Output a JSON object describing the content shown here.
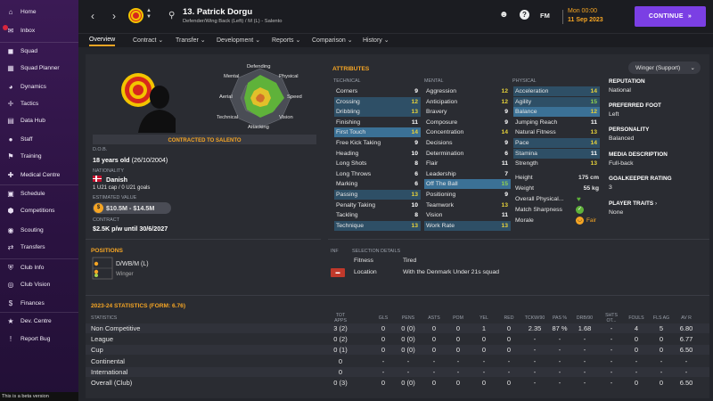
{
  "sidebar": {
    "items": [
      {
        "label": "Home",
        "icon": "home-icon"
      },
      {
        "label": "Inbox",
        "icon": "inbox-icon"
      },
      {
        "label": "Squad",
        "icon": "squad-icon"
      },
      {
        "label": "Squad Planner",
        "icon": "squad-planner-icon"
      },
      {
        "label": "Dynamics",
        "icon": "dynamics-icon"
      },
      {
        "label": "Tactics",
        "icon": "tactics-icon"
      },
      {
        "label": "Data Hub",
        "icon": "data-hub-icon"
      },
      {
        "label": "Staff",
        "icon": "staff-icon"
      },
      {
        "label": "Training",
        "icon": "training-icon"
      },
      {
        "label": "Medical Centre",
        "icon": "medical-icon"
      },
      {
        "label": "Schedule",
        "icon": "schedule-icon"
      },
      {
        "label": "Competitions",
        "icon": "competitions-icon"
      },
      {
        "label": "Scouting",
        "icon": "scouting-icon"
      },
      {
        "label": "Transfers",
        "icon": "transfers-icon"
      },
      {
        "label": "Club Info",
        "icon": "club-info-icon"
      },
      {
        "label": "Club Vision",
        "icon": "club-vision-icon"
      },
      {
        "label": "Finances",
        "icon": "finances-icon"
      },
      {
        "label": "Dev. Centre",
        "icon": "dev-centre-icon"
      },
      {
        "label": "Report Bug",
        "icon": "report-bug-icon"
      }
    ],
    "beta": "This is a beta version"
  },
  "header": {
    "player_name": "13. Patrick Dorgu",
    "player_desc": "Defender/Wing Back (Left) / M (L) - Salento",
    "date_line1": "Mon 00:00",
    "date_line2": "11 Sep 2023",
    "continue": "CONTINUE",
    "fm": "FM",
    "accent": "#7b3fe4"
  },
  "tabs": [
    "Overview",
    "Contract",
    "Transfer",
    "Development",
    "Reports",
    "Comparison",
    "History"
  ],
  "profile": {
    "contract_status": "CONTRACTED TO SALENTO",
    "dob_label": "D.O.B.",
    "dob": "18 years old",
    "dob_date": "(26/10/2004)",
    "nationality_label": "NATIONALITY",
    "nationality": "Danish",
    "caps": "1 U21 cap / 0 U21 goals",
    "value_label": "ESTIMATED VALUE",
    "value": "$10.5M - $14.5M",
    "contract_label": "CONTRACT",
    "contract": "$2.5K p/w until 30/6/2027",
    "radar": {
      "Defending": "Defending",
      "Physical": "Physical",
      "Speed": "Speed",
      "Vision": "Vision",
      "Attacking": "Attacking",
      "Technical": "Technical",
      "Aerial": "Aerial",
      "Mental": "Mental"
    }
  },
  "attributes": {
    "title": "ATTRIBUTES",
    "role": "Winger (Support)",
    "technical_label": "TECHNICAL",
    "mental_label": "MENTAL",
    "physical_label": "PHYSICAL",
    "technical": [
      [
        "Corners",
        "9",
        ""
      ],
      [
        "Crossing",
        "12",
        "hl"
      ],
      [
        "Dribbling",
        "13",
        "hl"
      ],
      [
        "Finishing",
        "11",
        ""
      ],
      [
        "First Touch",
        "14",
        "hl2"
      ],
      [
        "Free Kick Taking",
        "9",
        ""
      ],
      [
        "Heading",
        "10",
        ""
      ],
      [
        "Long Shots",
        "8",
        ""
      ],
      [
        "Long Throws",
        "6",
        ""
      ],
      [
        "Marking",
        "6",
        ""
      ],
      [
        "Passing",
        "13",
        "hl"
      ],
      [
        "Penalty Taking",
        "10",
        ""
      ],
      [
        "Tackling",
        "8",
        ""
      ],
      [
        "Technique",
        "13",
        "hl"
      ]
    ],
    "mental": [
      [
        "Aggression",
        "12",
        ""
      ],
      [
        "Anticipation",
        "12",
        ""
      ],
      [
        "Bravery",
        "9",
        ""
      ],
      [
        "Composure",
        "9",
        ""
      ],
      [
        "Concentration",
        "14",
        ""
      ],
      [
        "Decisions",
        "9",
        ""
      ],
      [
        "Determination",
        "6",
        ""
      ],
      [
        "Flair",
        "11",
        ""
      ],
      [
        "Leadership",
        "7",
        ""
      ],
      [
        "Off The Ball",
        "15",
        "hl2"
      ],
      [
        "Positioning",
        "9",
        ""
      ],
      [
        "Teamwork",
        "13",
        ""
      ],
      [
        "Vision",
        "11",
        ""
      ],
      [
        "Work Rate",
        "13",
        "hl"
      ]
    ],
    "physical": [
      [
        "Acceleration",
        "14",
        "hl"
      ],
      [
        "Agility",
        "15",
        "hl"
      ],
      [
        "Balance",
        "12",
        "hl2"
      ],
      [
        "Jumping Reach",
        "11",
        ""
      ],
      [
        "Natural Fitness",
        "13",
        ""
      ],
      [
        "Pace",
        "14",
        "hl"
      ],
      [
        "Stamina",
        "11",
        "hl"
      ],
      [
        "Strength",
        "13",
        ""
      ]
    ],
    "height_label": "Height",
    "height": "175 cm",
    "weight_label": "Weight",
    "weight": "55 kg",
    "overall_label": "Overall Physical...",
    "sharpness_label": "Match Sharpness",
    "morale_label": "Morale",
    "morale": "Fair"
  },
  "info": {
    "reputation_label": "REPUTATION",
    "reputation": "National",
    "foot_label": "PREFERRED FOOT",
    "foot": "Left",
    "personality_label": "PERSONALITY",
    "personality": "Balanced",
    "media_label": "MEDIA DESCRIPTION",
    "media": "Full-back",
    "gk_label": "GOALKEEPER RATING",
    "gk": "3",
    "traits_label": "PLAYER TRAITS",
    "traits": "None"
  },
  "positions": {
    "title": "POSITIONS",
    "pos": "D/WB/M (L)",
    "role": "Winger"
  },
  "selection": {
    "inf_label": "INF",
    "title": "SELECTION DETAILS",
    "fitness_label": "Fitness",
    "fitness": "Tired",
    "location_label": "Location",
    "location": "With the Denmark Under 21s squad"
  },
  "stats": {
    "title": "2023-24 STATISTICS (FORM: 6.76)",
    "headers": [
      "STATISTICS",
      "TOT APPS",
      "GLS",
      "PENS",
      "ASTS",
      "POM",
      "YEL",
      "RED",
      "TCKW/90",
      "PAS %",
      "DRB/90",
      "SHTS OT...",
      "FOULS",
      "FLS AG",
      "AV R"
    ],
    "rows": [
      [
        "Non Competitive",
        "3 (2)",
        "0",
        "0 (0)",
        "0",
        "0",
        "1",
        "0",
        "2.35",
        "87 %",
        "1.68",
        "-",
        "4",
        "5",
        "6.80"
      ],
      [
        "League",
        "0 (2)",
        "0",
        "0 (0)",
        "0",
        "0",
        "0",
        "0",
        "-",
        "-",
        "-",
        "-",
        "0",
        "0",
        "6.77"
      ],
      [
        "Cup",
        "0 (1)",
        "0",
        "0 (0)",
        "0",
        "0",
        "0",
        "0",
        "-",
        "-",
        "-",
        "-",
        "0",
        "0",
        "6.50"
      ],
      [
        "Continental",
        "0",
        "-",
        "-",
        "-",
        "-",
        "-",
        "-",
        "-",
        "-",
        "-",
        "-",
        "-",
        "-",
        "-"
      ],
      [
        "International",
        "0",
        "-",
        "-",
        "-",
        "-",
        "-",
        "-",
        "-",
        "-",
        "-",
        "-",
        "-",
        "-",
        "-"
      ],
      [
        "Overall (Club)",
        "0 (3)",
        "0",
        "0 (0)",
        "0",
        "0",
        "0",
        "0",
        "-",
        "-",
        "-",
        "-",
        "0",
        "0",
        "6.50"
      ]
    ]
  }
}
